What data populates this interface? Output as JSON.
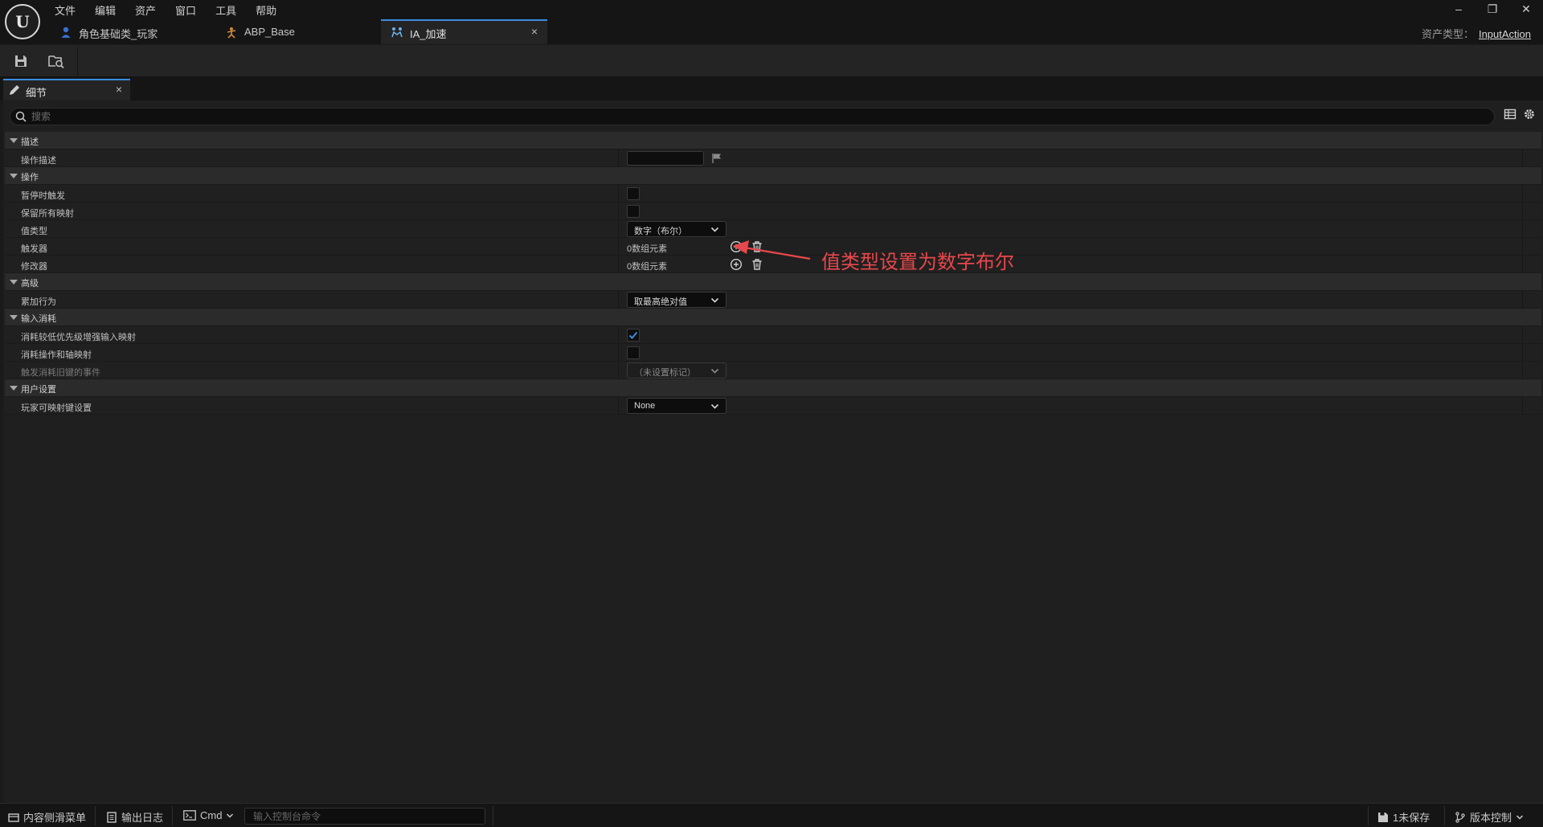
{
  "menu": [
    "文件",
    "编辑",
    "资产",
    "窗口",
    "工具",
    "帮助"
  ],
  "tabs": [
    {
      "label": "角色基础类_玩家",
      "icon": "character-blueprint-icon"
    },
    {
      "label": "ABP_Base",
      "icon": "animation-blueprint-icon"
    },
    {
      "label": "IA_加速",
      "icon": "input-action-icon",
      "active": true,
      "close": "×"
    }
  ],
  "window_controls": {
    "minimize": "–",
    "restore": "❐",
    "close": "✕"
  },
  "asset_type": {
    "label": "资产类型：",
    "value": "InputAction"
  },
  "toolbar": {
    "save_icon": "save-icon",
    "browse_icon": "browse-to-asset-icon"
  },
  "details_tab": {
    "label": "细节",
    "close": "×"
  },
  "search": {
    "placeholder": "搜索"
  },
  "categories": {
    "description": {
      "label": "描述",
      "props": {
        "action_description": "操作描述"
      }
    },
    "action": {
      "label": "操作",
      "props": {
        "trigger_when_paused": "暂停时触发",
        "reserve_all_mappings": "保留所有映射",
        "value_type": {
          "label": "值类型",
          "value": "数字（布尔）"
        },
        "triggers": {
          "label": "触发器",
          "value": "0数组元素"
        },
        "modifiers": {
          "label": "修改器",
          "value": "0数组元素"
        }
      }
    },
    "advanced": {
      "label": "高级",
      "props": {
        "accumulation_behavior": {
          "label": "累加行为",
          "value": "取最高绝对值"
        }
      }
    },
    "input_consumption": {
      "label": "输入消耗",
      "props": {
        "consume_lower_priority": {
          "label": "消耗较低优先级增强输入映射",
          "checked": true
        },
        "consume_action_axis": {
          "label": "消耗操作和轴映射",
          "checked": false
        },
        "trigger_legacy_events": {
          "label": "触发消耗旧键的事件",
          "value": "（未设置标记）"
        }
      }
    },
    "user_settings": {
      "label": "用户设置",
      "props": {
        "player_mappable_settings": {
          "label": "玩家可映射键设置",
          "value": "None"
        }
      }
    }
  },
  "annotation": {
    "text": "值类型设置为数字布尔",
    "color": "#e8474b"
  },
  "statusbar": {
    "content_drawer": "内容侧滑菜单",
    "output_log": "输出日志",
    "cmd": "Cmd",
    "console_placeholder": "输入控制台命令",
    "unsaved": "1未保存",
    "source_control": "版本控制"
  },
  "colors": {
    "accent": "#3b8be0",
    "annotation": "#e8474b",
    "background": "#1a1a1a"
  }
}
